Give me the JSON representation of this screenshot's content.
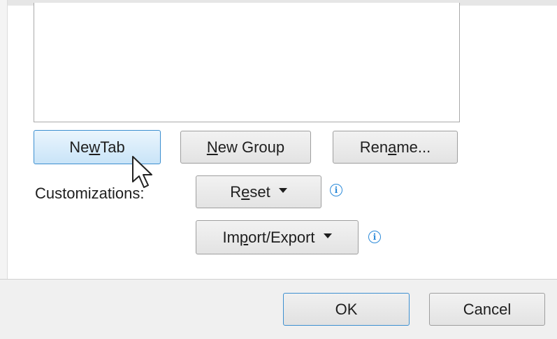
{
  "buttons": {
    "new_tab": {
      "pre": "Ne",
      "u": "w",
      "post": " Tab"
    },
    "new_group": {
      "pre": "",
      "u": "N",
      "post": "ew Group"
    },
    "rename": {
      "pre": "Ren",
      "u": "a",
      "post": "me..."
    },
    "reset": {
      "pre": "R",
      "u": "e",
      "post": "set"
    },
    "import_export": {
      "pre": "Im",
      "u": "p",
      "post": "ort/Export"
    },
    "ok": "OK",
    "cancel": "Cancel"
  },
  "customizations_label": "Customizations:",
  "info_icon_glyph": "i",
  "colors": {
    "accent": "#3c8fd0",
    "info": "#2b8ad9"
  }
}
